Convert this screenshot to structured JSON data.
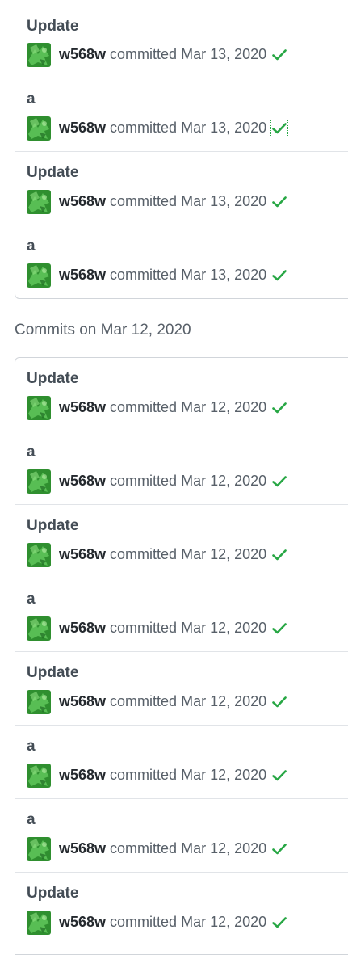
{
  "colors": {
    "check": "#28a745",
    "avatar_bg": "#2f8f2f",
    "avatar_leaf": "#5fc75a"
  },
  "groups": [
    {
      "heading": "",
      "commits": [
        {
          "title": "Update",
          "author": "w568w",
          "verb": "committed",
          "date": "Mar 13, 2020",
          "status_icon": "check-icon",
          "focused": false
        },
        {
          "title": "a",
          "author": "w568w",
          "verb": "committed",
          "date": "Mar 13, 2020",
          "status_icon": "check-icon",
          "focused": true
        },
        {
          "title": "Update",
          "author": "w568w",
          "verb": "committed",
          "date": "Mar 13, 2020",
          "status_icon": "check-icon",
          "focused": false
        },
        {
          "title": "a",
          "author": "w568w",
          "verb": "committed",
          "date": "Mar 13, 2020",
          "status_icon": "check-icon",
          "focused": false
        }
      ]
    },
    {
      "heading": "Commits on Mar 12, 2020",
      "commits": [
        {
          "title": "Update",
          "author": "w568w",
          "verb": "committed",
          "date": "Mar 12, 2020",
          "status_icon": "check-icon",
          "focused": false
        },
        {
          "title": "a",
          "author": "w568w",
          "verb": "committed",
          "date": "Mar 12, 2020",
          "status_icon": "check-icon",
          "focused": false
        },
        {
          "title": "Update",
          "author": "w568w",
          "verb": "committed",
          "date": "Mar 12, 2020",
          "status_icon": "check-icon",
          "focused": false
        },
        {
          "title": "a",
          "author": "w568w",
          "verb": "committed",
          "date": "Mar 12, 2020",
          "status_icon": "check-icon",
          "focused": false
        },
        {
          "title": "Update",
          "author": "w568w",
          "verb": "committed",
          "date": "Mar 12, 2020",
          "status_icon": "check-icon",
          "focused": false
        },
        {
          "title": "a",
          "author": "w568w",
          "verb": "committed",
          "date": "Mar 12, 2020",
          "status_icon": "check-icon",
          "focused": false
        },
        {
          "title": "a",
          "author": "w568w",
          "verb": "committed",
          "date": "Mar 12, 2020",
          "status_icon": "check-icon",
          "focused": false
        },
        {
          "title": "Update",
          "author": "w568w",
          "verb": "committed",
          "date": "Mar 12, 2020",
          "status_icon": "check-icon",
          "focused": false
        }
      ]
    }
  ]
}
